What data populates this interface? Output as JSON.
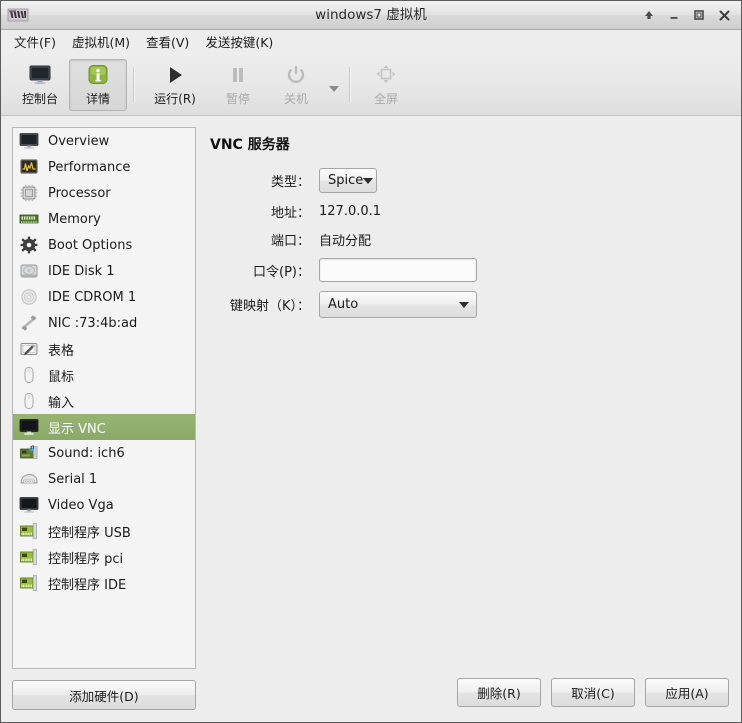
{
  "window": {
    "title": "windows7 虚拟机",
    "app_icon": "vm-logo-icon",
    "controls": {
      "shade": "↑",
      "minimize": "_",
      "maximize": "□",
      "close": "✕"
    }
  },
  "menubar": {
    "items": [
      {
        "label": "文件(F)",
        "name": "menu-file"
      },
      {
        "label": "虚拟机(M)",
        "name": "menu-virtual-machine"
      },
      {
        "label": "查看(V)",
        "name": "menu-view"
      },
      {
        "label": "发送按键(K)",
        "name": "menu-send-key"
      }
    ]
  },
  "toolbar": {
    "buttons": [
      {
        "label": "控制台",
        "icon": "monitor-icon",
        "active": false,
        "disabled": false
      },
      {
        "label": "详情",
        "icon": "info-icon",
        "active": true,
        "disabled": false
      },
      {
        "label": "运行(R)",
        "icon": "play-icon",
        "active": false,
        "disabled": false
      },
      {
        "label": "暂停",
        "icon": "pause-icon",
        "active": false,
        "disabled": true
      },
      {
        "label": "关机",
        "icon": "power-icon",
        "active": false,
        "disabled": true
      },
      {
        "label": "全屏",
        "icon": "fullscreen-icon",
        "active": false,
        "disabled": true
      }
    ]
  },
  "sidebar": {
    "items": [
      {
        "label": "Overview",
        "icon": "monitor-icon",
        "selected": false
      },
      {
        "label": "Performance",
        "icon": "performance-graph-icon",
        "selected": false
      },
      {
        "label": "Processor",
        "icon": "cpu-chip-icon",
        "selected": false
      },
      {
        "label": "Memory",
        "icon": "memory-ram-icon",
        "selected": false
      },
      {
        "label": "Boot Options",
        "icon": "gear-icon",
        "selected": false
      },
      {
        "label": "IDE Disk 1",
        "icon": "harddisk-icon",
        "selected": false
      },
      {
        "label": "IDE CDROM 1",
        "icon": "cdrom-disc-icon",
        "selected": false
      },
      {
        "label": "NIC :73:4b:ad",
        "icon": "network-cable-icon",
        "selected": false
      },
      {
        "label": "表格",
        "icon": "tablet-pen-icon",
        "selected": false
      },
      {
        "label": "鼠标",
        "icon": "mouse-icon",
        "selected": false
      },
      {
        "label": "输入",
        "icon": "mouse-icon",
        "selected": false
      },
      {
        "label": "显示 VNC",
        "icon": "monitor-icon",
        "selected": true
      },
      {
        "label": "Sound: ich6",
        "icon": "sound-card-icon",
        "selected": false
      },
      {
        "label": "Serial 1",
        "icon": "serial-port-icon",
        "selected": false
      },
      {
        "label": "Video Vga",
        "icon": "monitor-icon",
        "selected": false
      },
      {
        "label": "控制程序 USB",
        "icon": "controller-card-icon",
        "selected": false
      },
      {
        "label": "控制程序 pci",
        "icon": "controller-card-icon",
        "selected": false
      },
      {
        "label": "控制程序 IDE",
        "icon": "controller-card-icon",
        "selected": false
      }
    ],
    "add_hardware_label": "添加硬件(D)"
  },
  "panel": {
    "title": "VNC 服务器",
    "fields": {
      "type": {
        "label": "类型：",
        "value": "Spice"
      },
      "address": {
        "label": "地址：",
        "value": "127.0.0.1"
      },
      "port": {
        "label": "端口：",
        "value": "自动分配"
      },
      "password": {
        "label": "口令(P)：",
        "value": "",
        "placeholder": ""
      },
      "keymap": {
        "label": "键映射（K）：",
        "value": "Auto"
      }
    }
  },
  "actions": {
    "delete_label": "删除(R)",
    "cancel_label": "取消(C)",
    "apply_label": "应用(A)"
  },
  "colors": {
    "selection_green": "#8fb06a",
    "window_bg": "#ededed",
    "list_bg": "#f4f4f4"
  }
}
